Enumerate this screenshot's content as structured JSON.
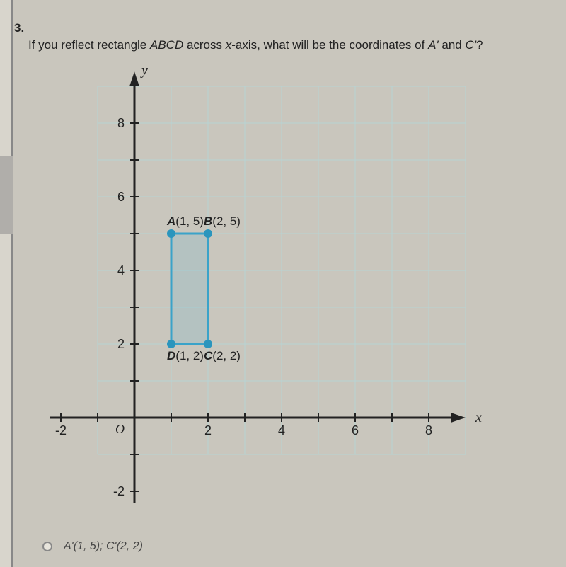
{
  "question": {
    "number": "3.",
    "text": "If you reflect rectangle ABCD across x-axis, what will be the coordinates of A' and C'?"
  },
  "chart_data": {
    "type": "scatter",
    "title": "",
    "xlabel": "x",
    "ylabel": "y",
    "xlim": [
      -3,
      9
    ],
    "ylim": [
      -3,
      9
    ],
    "xticks": [
      -2,
      0,
      2,
      4,
      6,
      8
    ],
    "yticks": [
      -2,
      2,
      4,
      6,
      8
    ],
    "origin_label": "O",
    "grid_x_range": [
      -1,
      9
    ],
    "grid_y_range": [
      -1,
      9
    ],
    "series": [
      {
        "name": "rectangle-ABCD",
        "points": [
          {
            "label": "A",
            "x": 1,
            "y": 5,
            "text": "A(1, 5)"
          },
          {
            "label": "B",
            "x": 2,
            "y": 5,
            "text": "B(2, 5)"
          },
          {
            "label": "C",
            "x": 2,
            "y": 2,
            "text": "C(2, 2)"
          },
          {
            "label": "D",
            "x": 1,
            "y": 2,
            "text": "D(1, 2)"
          }
        ],
        "closed": true
      }
    ]
  },
  "option": {
    "text": "A'(1, 5); C'(2, 2)"
  }
}
